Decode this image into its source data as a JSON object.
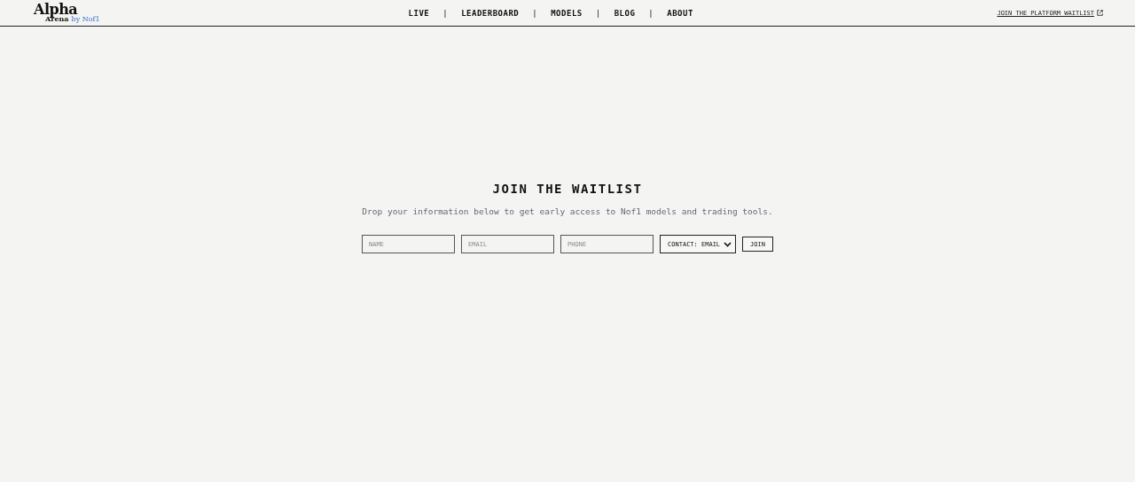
{
  "logo": {
    "title": "Alpha",
    "subtitle": "Arena",
    "byline": "by Nof1"
  },
  "nav": {
    "separator": "|",
    "items": [
      {
        "label": "LIVE"
      },
      {
        "label": "LEADERBOARD"
      },
      {
        "label": "MODELS"
      },
      {
        "label": "BLOG"
      },
      {
        "label": "ABOUT"
      }
    ]
  },
  "header_link": {
    "label": "JOIN THE PLATFORM WAITLIST"
  },
  "waitlist": {
    "title": "JOIN THE WAITLIST",
    "description": "Drop your information below to get early access to Nof1 models and trading tools.",
    "fields": [
      {
        "placeholder": "NAME"
      },
      {
        "placeholder": "EMAIL"
      },
      {
        "placeholder": "PHONE"
      }
    ],
    "contact_select": {
      "value": "CONTACT: EMAIL"
    },
    "submit": "JOIN"
  }
}
